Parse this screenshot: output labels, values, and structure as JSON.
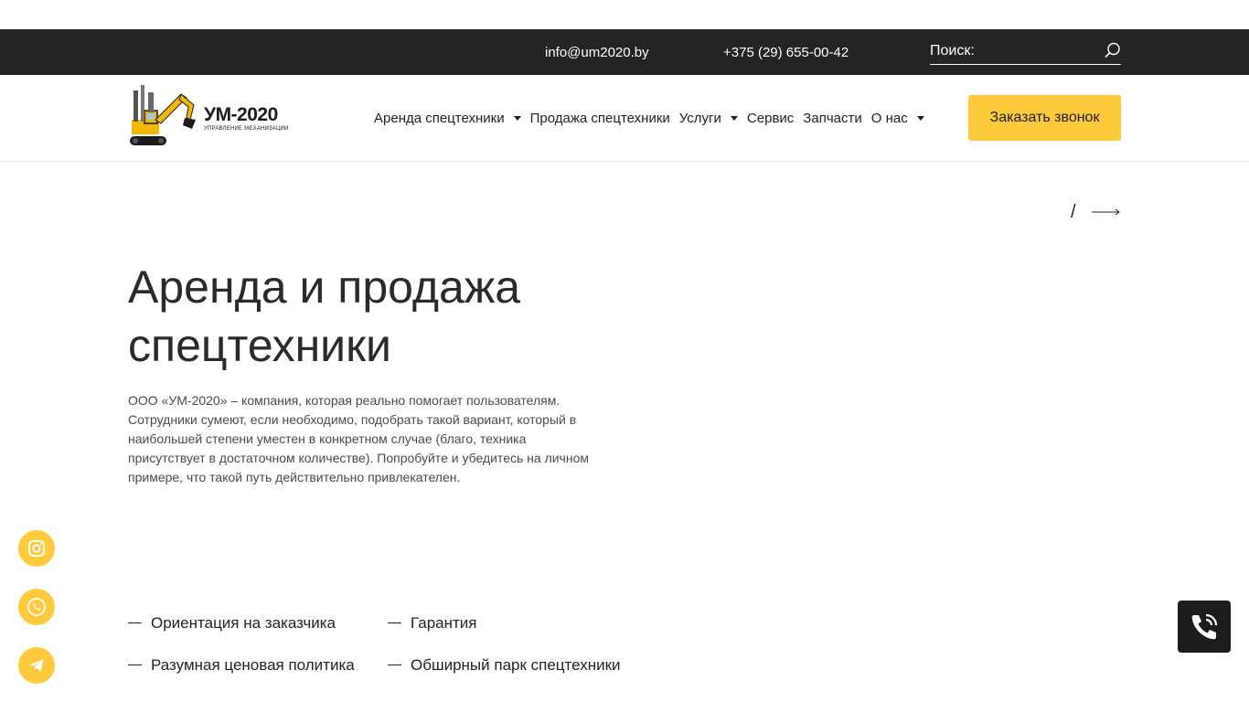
{
  "topbar": {
    "email": "info@um2020.by",
    "phone": "+375 (29) 655-00-42",
    "search_placeholder": "Поиск:"
  },
  "logo": {
    "text": "УМ-2020",
    "subtitle": "УПРАВЛЕНИЕ МЕХАНИЗАЦИИ"
  },
  "nav": {
    "items": [
      {
        "label": "Аренда спецтехники",
        "has_dropdown": true
      },
      {
        "label": "Продажа спецтехники",
        "has_dropdown": false
      },
      {
        "label": "Услуги",
        "has_dropdown": true
      },
      {
        "label": "Сервис",
        "has_dropdown": false
      },
      {
        "label": "Запчасти",
        "has_dropdown": false
      },
      {
        "label": "О нас",
        "has_dropdown": true
      }
    ]
  },
  "header": {
    "cta_label": "Заказать звонок"
  },
  "slider": {
    "separator": "/"
  },
  "hero": {
    "title_line1": "Аренда и продажа",
    "title_line2": "спецтехники",
    "text": "ООО «УМ-2020» – компания, которая реально помогает пользователям. Сотрудники сумеют, если необходимо, подобрать такой вариант, который в наибольшей степени уместен в конкретном случае (благо, техника присутствует в достаточном количестве). Попробуйте и убедитесь на личном примере, что такой путь действительно привлекателен."
  },
  "features": [
    "Ориентация на заказчика",
    "Гарантия",
    "Разумная ценовая политика",
    "Обширный парк спецтехники"
  ],
  "social": {
    "icons": [
      "instagram-icon",
      "viber-icon",
      "telegram-icon"
    ]
  },
  "colors": {
    "accent": "#ffc93c",
    "topbar_bg": "#242424",
    "dark_button": "#1c1c1c"
  }
}
